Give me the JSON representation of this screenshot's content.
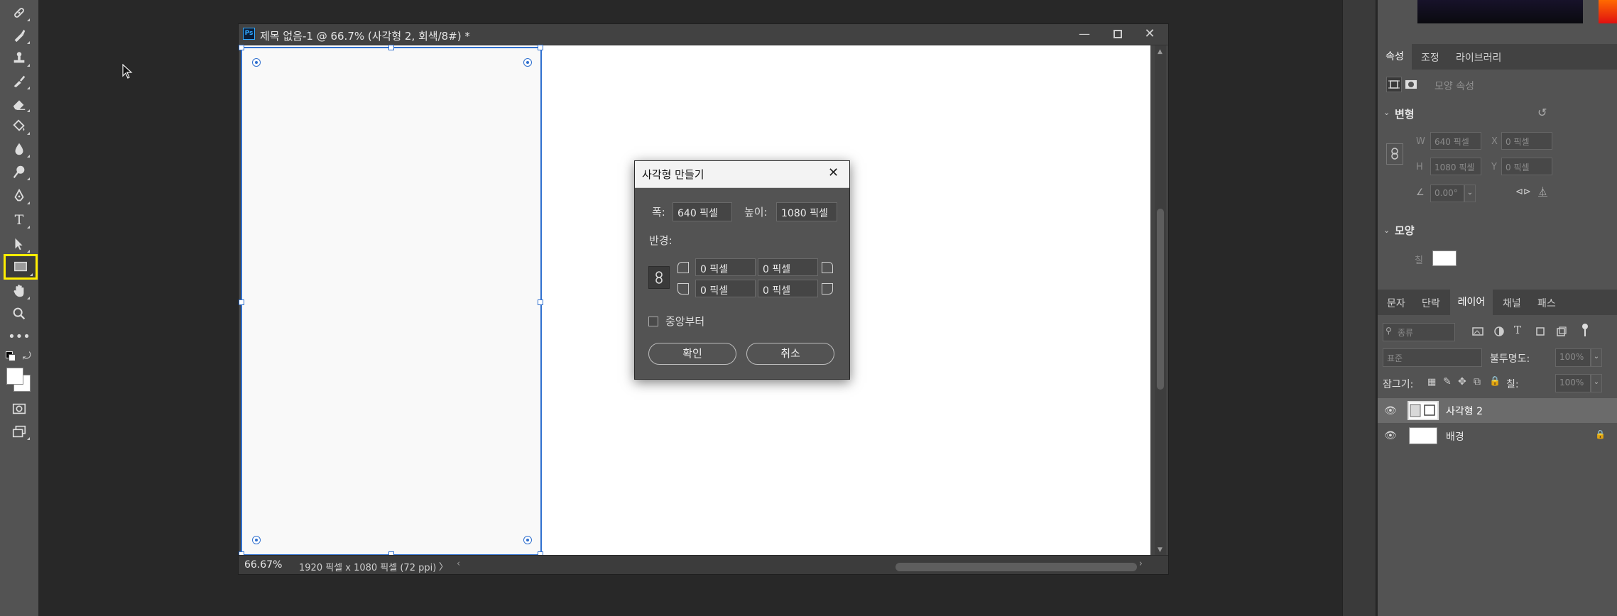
{
  "document": {
    "title": "제목 없음-1 @ 66.7% (사각형 2, 회색/8#) *",
    "ps_badge": "Ps",
    "zoom": "66.67%",
    "doc_info": "1920 픽셀 x 1080 픽셀 (72 ppi)",
    "status_arrow": "〉",
    "hscroll_left": "‹",
    "hscroll_right": "›"
  },
  "dialog": {
    "title": "사각형 만들기",
    "width_label": "폭:",
    "width_value": "640 픽셀",
    "height_label": "높이:",
    "height_value": "1080 픽셀",
    "radius_label": "반경:",
    "radius_values": [
      "0 픽셀",
      "0 픽셀",
      "0 픽셀",
      "0 픽셀"
    ],
    "from_center_label": "중앙부터",
    "from_center_checked": false,
    "ok_label": "확인",
    "cancel_label": "취소"
  },
  "properties_panel": {
    "tabs": [
      "속성",
      "조정",
      "라이브러리"
    ],
    "active_tab": "속성",
    "shape_props_label": "모양 속성",
    "transform_section": "변형",
    "w_label": "W",
    "w_value": "640 픽셀",
    "h_label": "H",
    "h_value": "1080 픽셀",
    "x_label": "X",
    "x_value": "0 픽셀",
    "y_label": "Y",
    "y_value": "0 픽셀",
    "angle_value": "0.00°",
    "shape_section": "모양",
    "fill_label": "칠"
  },
  "layers_panel": {
    "tabs": [
      "문자",
      "단락",
      "레이어",
      "채널",
      "패스"
    ],
    "active_tab": "레이어",
    "filter_placeholder": "종류",
    "blend_mode": "표준",
    "opacity_label": "불투명도:",
    "opacity_value": "100%",
    "lock_label": "잠그기:",
    "fill_label": "칠:",
    "fill_value": "100%",
    "layers": [
      {
        "name": "사각형 2",
        "selected": true
      },
      {
        "name": "배경",
        "selected": false
      }
    ]
  },
  "colors": {
    "accent": "#2f6fce",
    "tool_highlight": "#ffee00",
    "swatch_fg": "#ffffff",
    "swatch_bg": "#ffffff"
  }
}
